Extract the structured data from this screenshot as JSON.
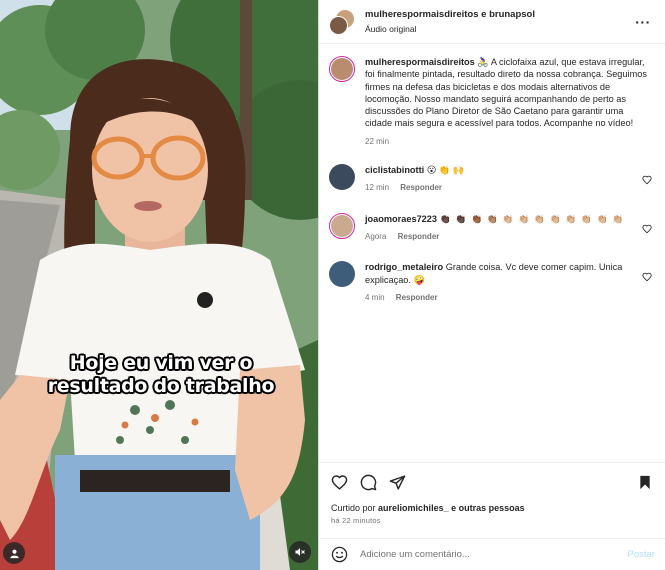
{
  "post": {
    "header": {
      "users": "mulherespormaisdireitos e brunapsol",
      "audio": "Áudio original",
      "more_icon": "more-horizontal-icon"
    },
    "video_caption_lines": [
      "Hoje eu vim ver o",
      "resultado do trabalho"
    ],
    "caption": {
      "username": "mulherespormaisdireitos",
      "text": "🚴‍♀️ A ciclofaixa azul, que estava irregular, foi finalmente pintada, resultado direto da nossa cobrança. Seguimos firmes na defesa das bicicletas e dos modais alternativos de locomoção. Nosso mandato seguirá acompanhando de perto as discussões do Plano Diretor de São Caetano para garantir uma cidade mais segura e acessível para todos. Acompanhe no vídeo!",
      "time": "22 min"
    },
    "comments": [
      {
        "username": "ciclistabinotti",
        "text": "😮 👏 🙌",
        "time": "12 min",
        "reply": "Responder"
      },
      {
        "username": "joaomoraes7223",
        "text": "👏🏿 👏🏿 👏🏾 👏🏽 👏🏼 👏🏼 👏🏼 👏🏼 👏🏼 👏🏼 👏🏼 👏🏼",
        "time": "Agora",
        "reply": "Responder"
      },
      {
        "username": "rodrigo_metaleiro",
        "text": "Grande coisa. Vc deve comer capim. Unica explicaçao. 🤪",
        "time": "4 min",
        "reply": "Responder"
      }
    ],
    "liked_by": {
      "prefix": "Curtido por",
      "user": "aurelіomichiles_",
      "suffix": "e outras pessoas"
    },
    "posted_ago": "há 22 minutos",
    "add_comment": {
      "placeholder": "Adicione um comentário...",
      "post_label": "Postar"
    },
    "colors": {
      "accent_disabled": "#b2dffc",
      "muted_text": "#737373",
      "text": "#262626"
    }
  }
}
